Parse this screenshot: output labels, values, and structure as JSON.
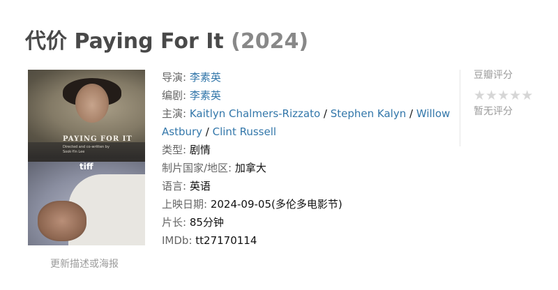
{
  "header": {
    "title": "代价 Paying For It",
    "year": "(2024)"
  },
  "poster": {
    "title_text": "PAYING FOR IT",
    "sub_text": "Directed and co-written by Sook-Yin Lee",
    "badge": "tiff",
    "update_link": "更新描述或海报"
  },
  "info": {
    "director_label": "导演:",
    "director": "李素英",
    "writer_label": "编剧:",
    "writer": "李素英",
    "cast_label": "主演:",
    "cast": [
      "Kaitlyn Chalmers-Rizzato",
      "Stephen Kalyn",
      "Willow Astbury",
      "Clint Russell"
    ],
    "cast_separator": " / ",
    "genre_label": "类型:",
    "genre": "剧情",
    "country_label": "制片国家/地区:",
    "country": "加拿大",
    "language_label": "语言:",
    "language": "英语",
    "release_label": "上映日期:",
    "release": "2024-09-05(多伦多电影节)",
    "runtime_label": "片长:",
    "runtime": "85分钟",
    "imdb_label": "IMDb:",
    "imdb": "tt27170114"
  },
  "rating": {
    "label": "豆瓣评分",
    "stars_filled": 0,
    "stars_total": 5,
    "star_color": "#d6d6d6",
    "no_rating_text": "暂无评分"
  },
  "colors": {
    "link": "#3377aa",
    "label": "#666666",
    "title": "#494949",
    "year": "#888888"
  }
}
